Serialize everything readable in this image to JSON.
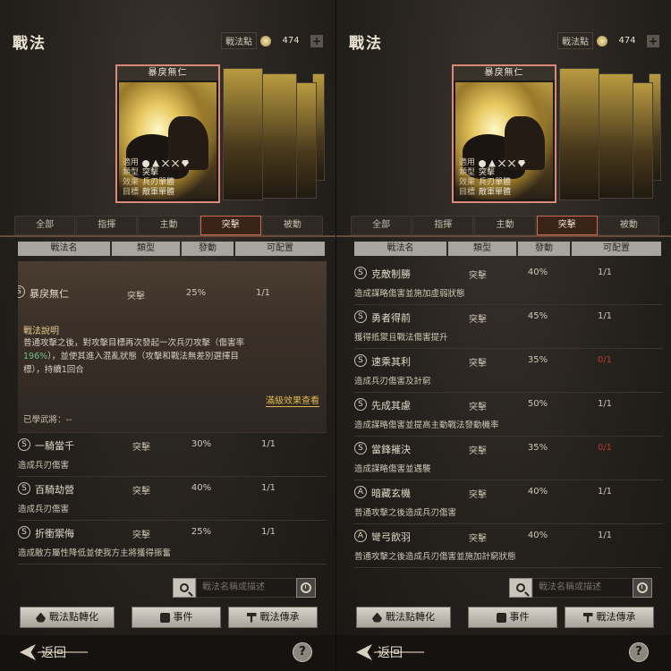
{
  "panels": [
    {
      "title": "戰法",
      "points_label": "戰法點",
      "points_value": "474",
      "card": {
        "name": "暴戾無仁",
        "info": [
          {
            "k": "適用",
            "v": ""
          },
          {
            "k": "類型",
            "v": "突擊"
          },
          {
            "k": "效果",
            "v": "兵刃單體"
          },
          {
            "k": "目標",
            "v": "敵軍單體"
          }
        ]
      },
      "tabs": [
        "全部",
        "指揮",
        "主動",
        "突擊",
        "被動"
      ],
      "active_tab": 3,
      "headers": [
        "戰法名",
        "類型",
        "發動",
        "可配置"
      ],
      "expanded": {
        "icon": "S",
        "name": "暴戾無仁",
        "type": "突擊",
        "pct": "25%",
        "cfg": "1/1",
        "desc_title": "戰法說明",
        "desc_1": "普通攻擊之後，對攻擊目標再次發起一次兵刃攻擊（傷害率",
        "desc_green": "196%",
        "desc_2": "），並使其進入混亂狀態（攻擊和戰法無差別選擇目",
        "desc_3": "標），持續1回合",
        "link": "滿級效果查看",
        "learned": "已學武將：--"
      },
      "rows": [
        {
          "icon": "S",
          "name": "一騎當千",
          "type": "突擊",
          "pct": "30%",
          "cfg": "1/1",
          "cfg_red": false,
          "desc": "造成兵刃傷害"
        },
        {
          "icon": "S",
          "name": "百騎劫營",
          "type": "突擊",
          "pct": "40%",
          "cfg": "1/1",
          "cfg_red": false,
          "desc": "造成兵刃傷害"
        },
        {
          "icon": "S",
          "name": "折衝禦侮",
          "type": "突擊",
          "pct": "25%",
          "cfg": "1/1",
          "cfg_red": false,
          "desc": "造成敵方屬性降低並使我方主將獲得振奮"
        }
      ],
      "search_placeholder": "戰法名稱或描述",
      "buttons": [
        "戰法點轉化",
        "事件",
        "戰法傳承"
      ],
      "back": "返回",
      "help": "?"
    },
    {
      "title": "戰法",
      "points_label": "戰法點",
      "points_value": "474",
      "card": {
        "name": "暴戾無仁",
        "info": [
          {
            "k": "適用",
            "v": ""
          },
          {
            "k": "類型",
            "v": "突擊"
          },
          {
            "k": "效果",
            "v": "兵刃單體"
          },
          {
            "k": "目標",
            "v": "敵軍單體"
          }
        ]
      },
      "tabs": [
        "全部",
        "指揮",
        "主動",
        "突擊",
        "被動"
      ],
      "active_tab": 3,
      "headers": [
        "戰法名",
        "類型",
        "發動",
        "可配置"
      ],
      "rows": [
        {
          "icon": "S",
          "name": "克敵制勝",
          "type": "突擊",
          "pct": "40%",
          "cfg": "1/1",
          "cfg_red": false,
          "desc": "造成謀略傷害並施加虛弱狀態"
        },
        {
          "icon": "S",
          "name": "勇者得前",
          "type": "突擊",
          "pct": "45%",
          "cfg": "1/1",
          "cfg_red": false,
          "desc": "獲得抵禦且戰法傷害提升"
        },
        {
          "icon": "S",
          "name": "速乘其利",
          "type": "突擊",
          "pct": "35%",
          "cfg": "0/1",
          "cfg_red": true,
          "desc": "造成兵刃傷害及計窮"
        },
        {
          "icon": "S",
          "name": "先成其慮",
          "type": "突擊",
          "pct": "50%",
          "cfg": "1/1",
          "cfg_red": false,
          "desc": "造成謀略傷害並提高主動戰法發動機率"
        },
        {
          "icon": "S",
          "name": "當鋒摧決",
          "type": "突擊",
          "pct": "35%",
          "cfg": "0/1",
          "cfg_red": true,
          "desc": "造成謀略傷害並遇襲"
        },
        {
          "icon": "A",
          "name": "暗藏玄機",
          "type": "突擊",
          "pct": "40%",
          "cfg": "1/1",
          "cfg_red": false,
          "desc": "普通攻擊之後造成兵刃傷害"
        },
        {
          "icon": "A",
          "name": "彎弓飲羽",
          "type": "突擊",
          "pct": "40%",
          "cfg": "1/1",
          "cfg_red": false,
          "desc": "普通攻擊之後造成兵刃傷害並施加計窮狀態"
        }
      ],
      "search_placeholder": "戰法名稱或描述",
      "buttons": [
        "戰法點轉化",
        "事件",
        "戰法傳承"
      ],
      "back": "返回",
      "help": "?"
    }
  ]
}
